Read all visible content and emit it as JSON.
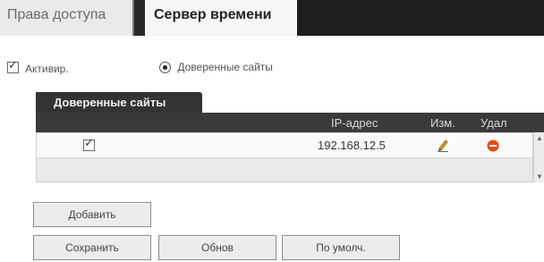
{
  "tabs": [
    {
      "label": "Права доступа",
      "active": false
    },
    {
      "label": "Сервер времени",
      "active": true
    }
  ],
  "options": {
    "activate_label": "Активир.",
    "activate_checked": true,
    "trusted_radio_label": "Доверенные сайты",
    "trusted_radio_selected": true
  },
  "section": {
    "title": "Доверенные сайты"
  },
  "table": {
    "headers": [
      "IP-адрес",
      "Изм.",
      "Удал"
    ],
    "rows": [
      {
        "checked": true,
        "ip": "192.168.12.5",
        "edit_icon": "pencil-icon",
        "delete_icon": "minus-circle-icon"
      }
    ]
  },
  "buttons": {
    "add": "Добавить",
    "save": "Сохранить",
    "refresh": "Обнов",
    "default": "По умолч."
  },
  "colors": {
    "tab_bar": "#1f1f1f",
    "header": "#3a3a3a",
    "delete": "#e8490f",
    "edit": "#e0a020"
  }
}
